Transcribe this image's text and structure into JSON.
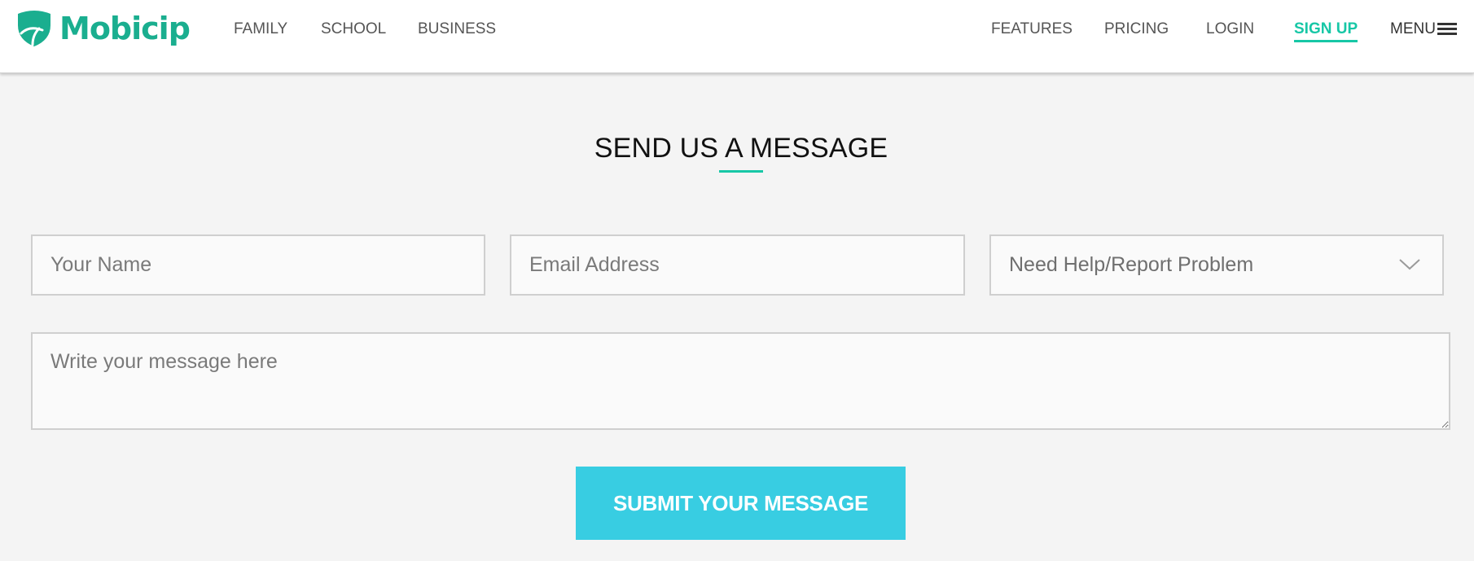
{
  "brand": {
    "name": "Mobicip",
    "color": "#1aae8f"
  },
  "nav_left": [
    {
      "label": "FAMILY"
    },
    {
      "label": "SCHOOL"
    },
    {
      "label": "BUSINESS"
    }
  ],
  "nav_right": {
    "features": "FEATURES",
    "pricing": "PRICING",
    "login": "LOGIN",
    "signup": "SIGN UP",
    "menu": "MENU"
  },
  "colors": {
    "accent": "#17c7a6",
    "button": "#38cde2",
    "page_bg": "#f4f4f4"
  },
  "section": {
    "title": "SEND US A MESSAGE"
  },
  "form": {
    "name_placeholder": "Your Name",
    "email_placeholder": "Email Address",
    "topic_selected": "Need Help/Report Problem",
    "message_placeholder": "Write your message here",
    "submit_label": "SUBMIT YOUR MESSAGE"
  }
}
